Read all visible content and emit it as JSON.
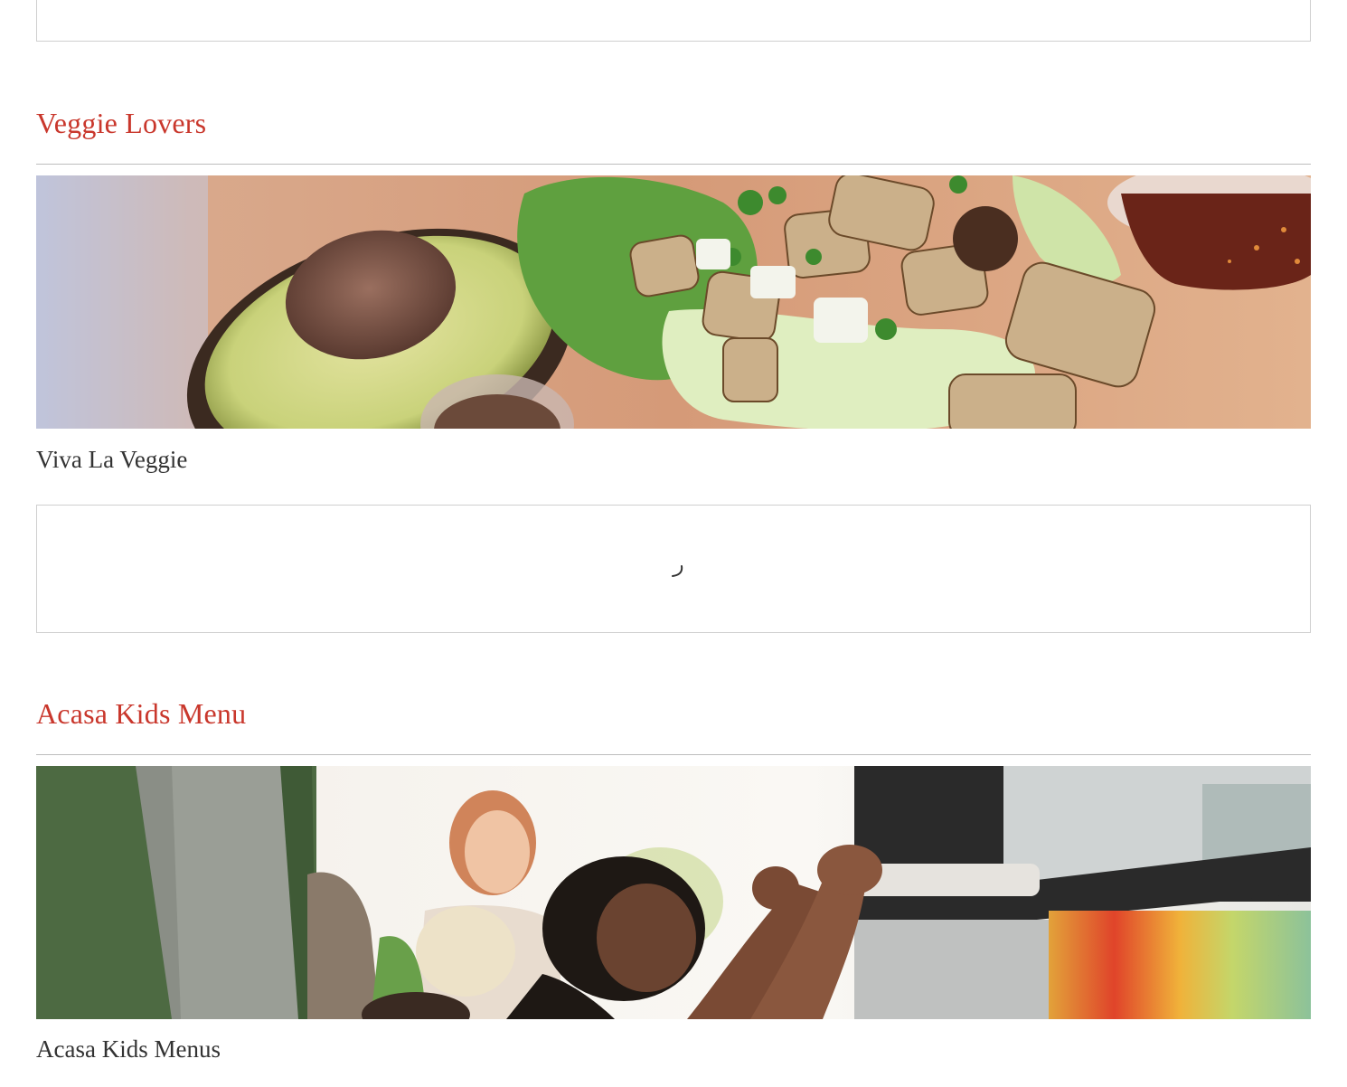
{
  "sections": [
    {
      "title": "Veggie Lovers",
      "item": {
        "name": "Viva La Veggie",
        "image": "tacos-avocado-photo"
      }
    },
    {
      "title": "Acasa Kids Menu",
      "item": {
        "name": "Acasa Kids Menus",
        "image": "kids-food-truck-photo"
      }
    }
  ],
  "colors": {
    "accent": "#c9372c",
    "text": "#333333",
    "border": "#cfcfcf"
  }
}
